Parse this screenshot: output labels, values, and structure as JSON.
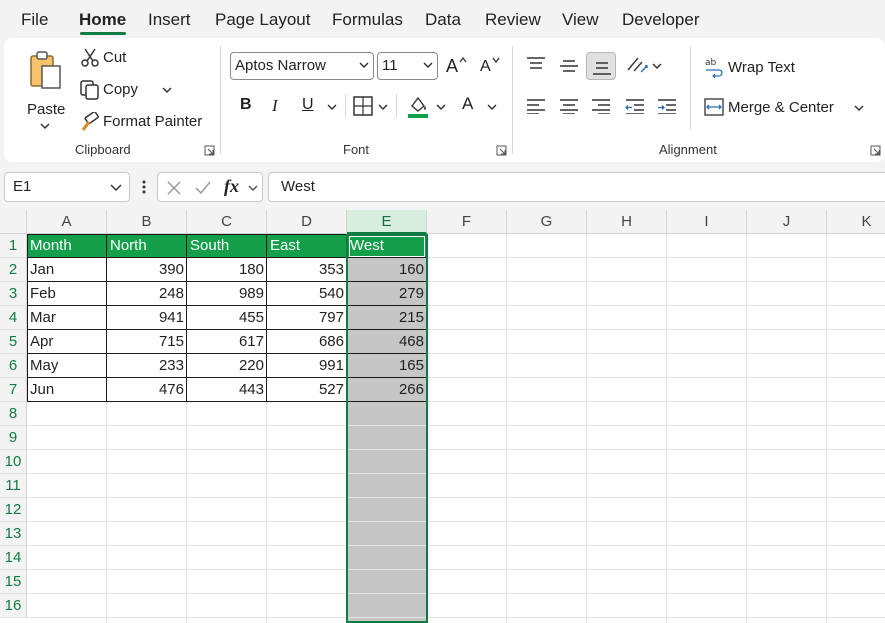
{
  "menu": {
    "tabs": [
      "File",
      "Home",
      "Insert",
      "Page Layout",
      "Formulas",
      "Data",
      "Review",
      "View",
      "Developer"
    ],
    "active": "Home"
  },
  "ribbon": {
    "clipboard": {
      "paste": "Paste",
      "cut": "Cut",
      "copy": "Copy",
      "format_painter": "Format Painter",
      "group_label": "Clipboard"
    },
    "font": {
      "font_name": "Aptos Narrow",
      "font_size": "11",
      "bold": "B",
      "italic": "I",
      "underline": "U",
      "font_color_glyph": "A",
      "grow_glyph": "A",
      "shrink_glyph": "A",
      "group_label": "Font"
    },
    "alignment": {
      "wrap_text": "Wrap Text",
      "merge_center": "Merge & Center",
      "group_label": "Alignment"
    }
  },
  "formula_bar": {
    "name_box": "E1",
    "fx": "fx",
    "content": "West"
  },
  "sheet": {
    "columns": [
      "A",
      "B",
      "C",
      "D",
      "E",
      "F",
      "G",
      "H",
      "I",
      "J",
      "K"
    ],
    "rows": [
      "1",
      "2",
      "3",
      "4",
      "5",
      "6",
      "7",
      "8",
      "9",
      "10",
      "11",
      "12",
      "13",
      "14",
      "15",
      "16"
    ],
    "selected_column": "E",
    "selected_cell": "E1",
    "header_fill": "#14a04a",
    "selection_fill": "#c6c6c6",
    "table": {
      "headers": [
        "Month",
        "North",
        "South",
        "East",
        "West"
      ],
      "rows": [
        [
          "Jan",
          "390",
          "180",
          "353",
          "160"
        ],
        [
          "Feb",
          "248",
          "989",
          "540",
          "279"
        ],
        [
          "Mar",
          "941",
          "455",
          "797",
          "215"
        ],
        [
          "Apr",
          "715",
          "617",
          "686",
          "468"
        ],
        [
          "May",
          "233",
          "220",
          "991",
          "165"
        ],
        [
          "Jun",
          "476",
          "443",
          "527",
          "266"
        ]
      ]
    }
  },
  "colors": {
    "accent": "#107c41",
    "ribbon_bg": "#ffffff",
    "app_bg": "#f3f3f3"
  }
}
